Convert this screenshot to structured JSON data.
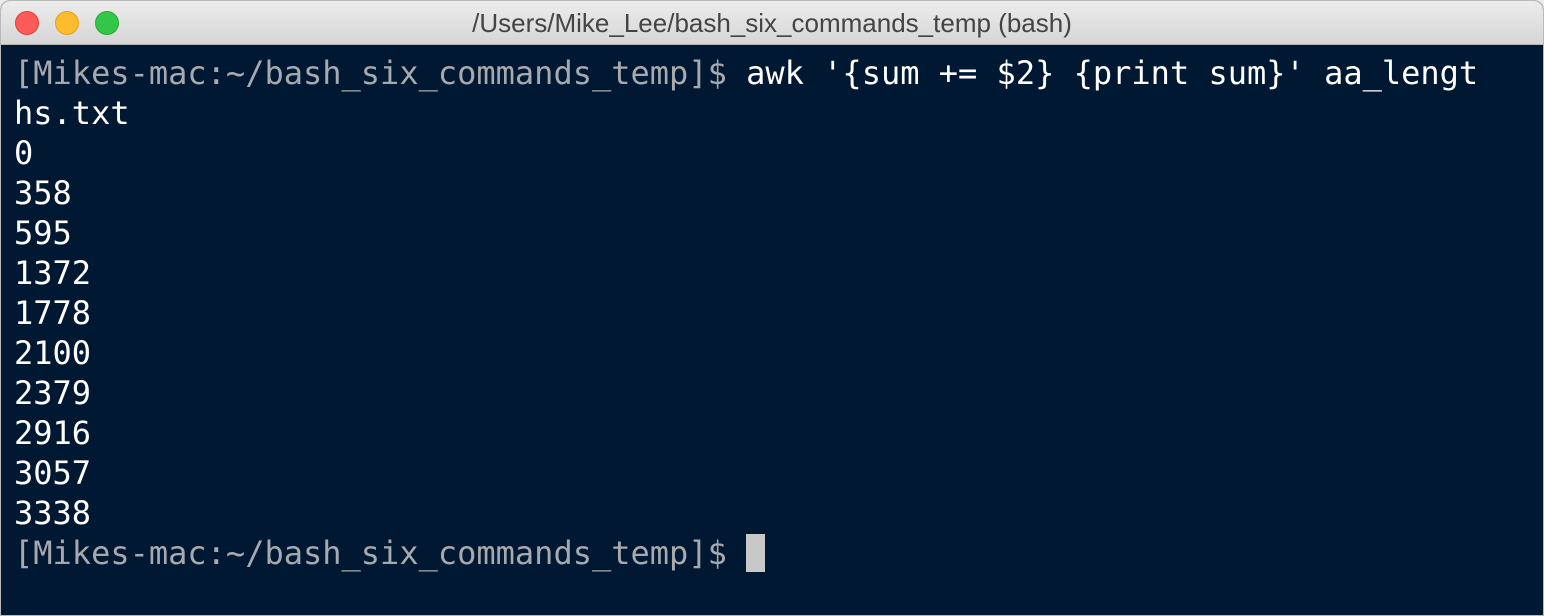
{
  "window": {
    "title": "/Users/Mike_Lee/bash_six_commands_temp (bash)"
  },
  "terminal": {
    "prompt": "[Mikes-mac:~/bash_six_commands_temp]$",
    "command_part1": " awk '{sum += $2} {print sum}' aa_lengt",
    "command_part2": "hs.txt",
    "output": [
      "0",
      "358",
      "595",
      "1372",
      "1778",
      "2100",
      "2379",
      "2916",
      "3057",
      "3338"
    ],
    "final_prompt": "[Mikes-mac:~/bash_six_commands_temp]$"
  }
}
